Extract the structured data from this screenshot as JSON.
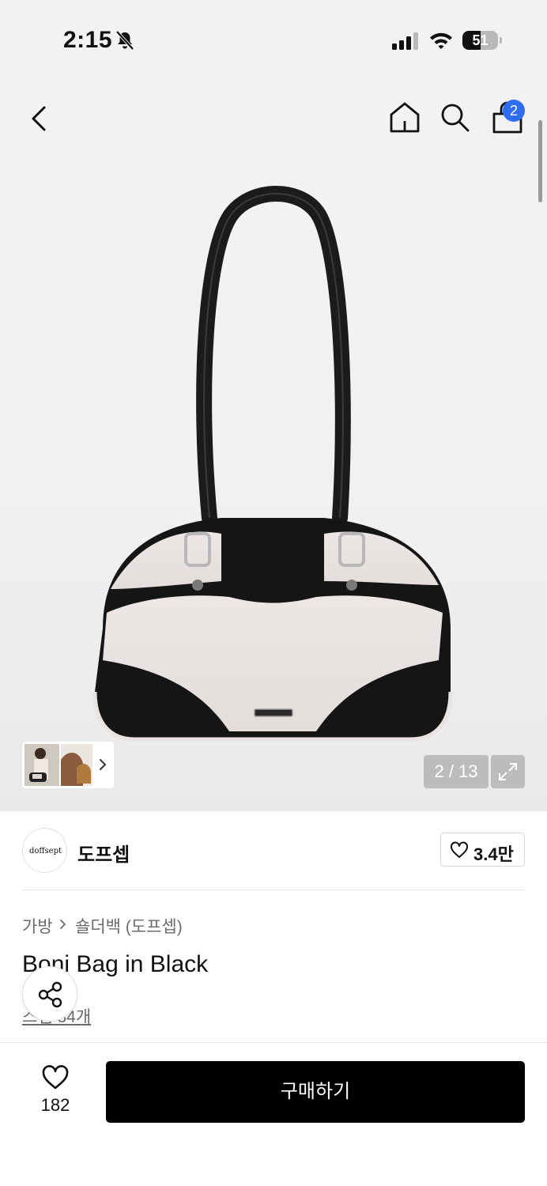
{
  "status_bar": {
    "time": "2:15",
    "battery": "51",
    "battery_level": 0.51
  },
  "nav": {
    "cart_count": "2"
  },
  "gallery": {
    "page_counter": "2 / 13"
  },
  "brand": {
    "logo_text": "doffsept",
    "name": "도프셉",
    "follow_count": "3.4만"
  },
  "breadcrumb": {
    "category": "가방",
    "subcategory": "숄더백 (도프셉)"
  },
  "product": {
    "title": "Boni Bag in Black",
    "snap_link": "스냅 34개"
  },
  "bottom_bar": {
    "like_count": "182",
    "buy_label": "구매하기"
  },
  "colors": {
    "accent_badge": "#2e6cf0",
    "buy_button": "#000000"
  }
}
